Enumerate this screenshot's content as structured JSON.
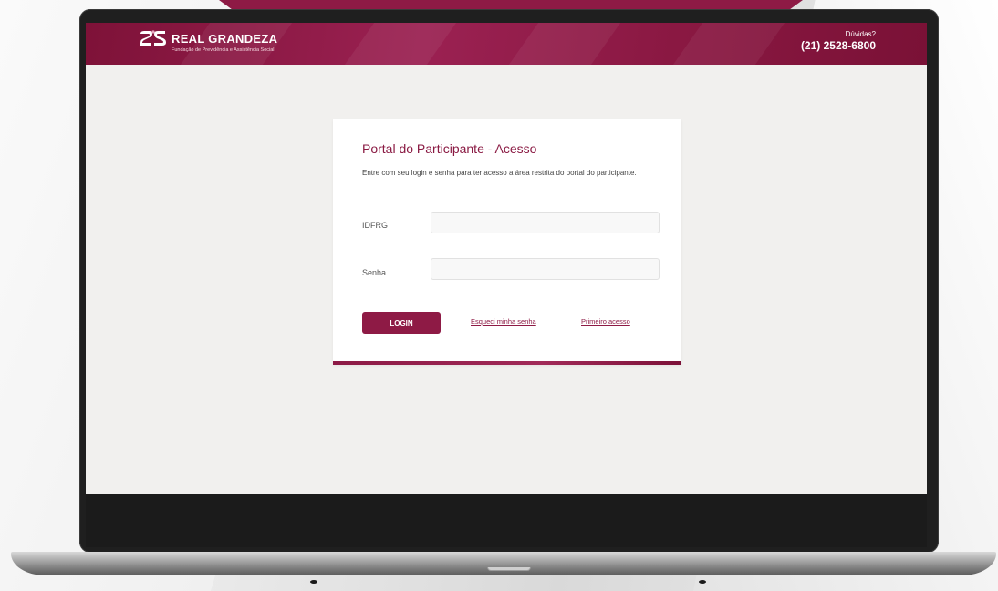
{
  "header": {
    "brand_name": "REAL GRANDEZA",
    "brand_subtitle": "Fundação de Previdência e Assistência Social",
    "contact_question": "Dúvidas?",
    "contact_phone": "(21) 2528-6800"
  },
  "login_card": {
    "title": "Portal do Participante - Acesso",
    "description": "Entre com seu login e senha para ter acesso a área restrita do portal do participante.",
    "fields": [
      {
        "label": "IDFRG",
        "value": "",
        "placeholder": ""
      },
      {
        "label": "Senha",
        "value": "",
        "placeholder": ""
      }
    ],
    "login_label": "LOGIN",
    "forgot_label": "Esqueci minha senha",
    "first_access_label": "Primeiro acesso"
  },
  "colors": {
    "brand": "#8e1a45",
    "header_dark": "#7e1238",
    "screen_bg": "#f1f0ee"
  },
  "icons": {
    "logo": "rg-logo-icon"
  }
}
